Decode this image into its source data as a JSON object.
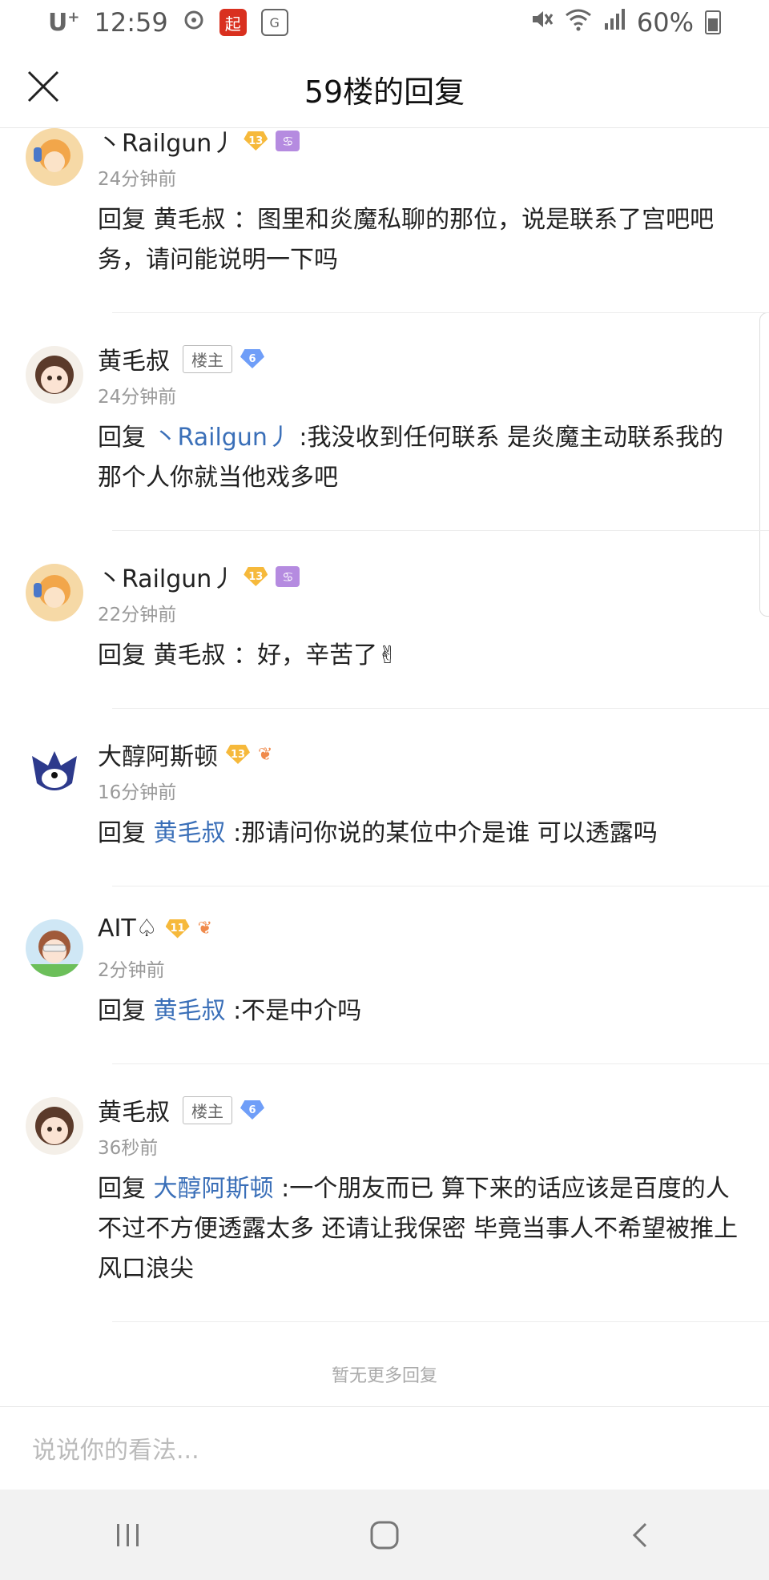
{
  "status_bar": {
    "carrier": "U",
    "carrier_sup": "+",
    "time": "12:59",
    "app_icon_red": "起",
    "app_icon_translate": "G",
    "battery": "60%"
  },
  "header": {
    "title": "59楼的回复"
  },
  "comments": [
    {
      "user": "丶Railgun丿",
      "level": "13",
      "level_color": "gold",
      "badge": "zodiac",
      "zodiac_glyph": "♋",
      "is_op": false,
      "time": "24分钟前",
      "reply_prefix": "回复",
      "reply_target": "黄毛叔",
      "target_is_link": false,
      "text": "：图里和炎魔私聊的那位，说是联系了宫吧吧务，请问能说明一下吗"
    },
    {
      "user": "黄毛叔",
      "op_label": "楼主",
      "level": "6",
      "level_color": "blue",
      "is_op": true,
      "time": "24分钟前",
      "reply_prefix": "回复",
      "reply_target": "丶Railgun丿",
      "target_is_link": true,
      "text": ":我没收到任何联系 是炎魔主动联系我的那个人你就当他戏多吧"
    },
    {
      "user": "丶Railgun丿",
      "level": "13",
      "level_color": "gold",
      "badge": "zodiac",
      "zodiac_glyph": "♋",
      "is_op": false,
      "time": "22分钟前",
      "reply_prefix": "回复",
      "reply_target": "黄毛叔",
      "target_is_link": false,
      "text": "：好，辛苦了✌"
    },
    {
      "user": "大醇阿斯顿",
      "level": "13",
      "level_color": "gold",
      "badge": "lungs",
      "is_op": false,
      "time": "16分钟前",
      "reply_prefix": "回复",
      "reply_target": "黄毛叔",
      "target_is_link": true,
      "text": ":那请问你说的某位中介是谁 可以透露吗"
    },
    {
      "user": "AIT♤",
      "level": "11",
      "level_color": "gold",
      "badge": "lungs",
      "is_op": false,
      "time": "2分钟前",
      "reply_prefix": "回复",
      "reply_target": "黄毛叔",
      "target_is_link": true,
      "text": ":不是中介吗"
    },
    {
      "user": "黄毛叔",
      "op_label": "楼主",
      "level": "6",
      "level_color": "blue",
      "is_op": true,
      "time": "36秒前",
      "reply_prefix": "回复",
      "reply_target": "大醇阿斯顿",
      "target_is_link": true,
      "text": ":一个朋友而已 算下来的话应该是百度的人 不过不方便透露太多 还请让我保密 毕竟当事人不希望被推上风口浪尖"
    }
  ],
  "footer_note": "暂无更多回复",
  "input": {
    "placeholder": "说说你的看法..."
  },
  "colors": {
    "link": "#3a6fb8",
    "level_gold": "#f6b93b",
    "level_blue": "#6f9ef8"
  }
}
